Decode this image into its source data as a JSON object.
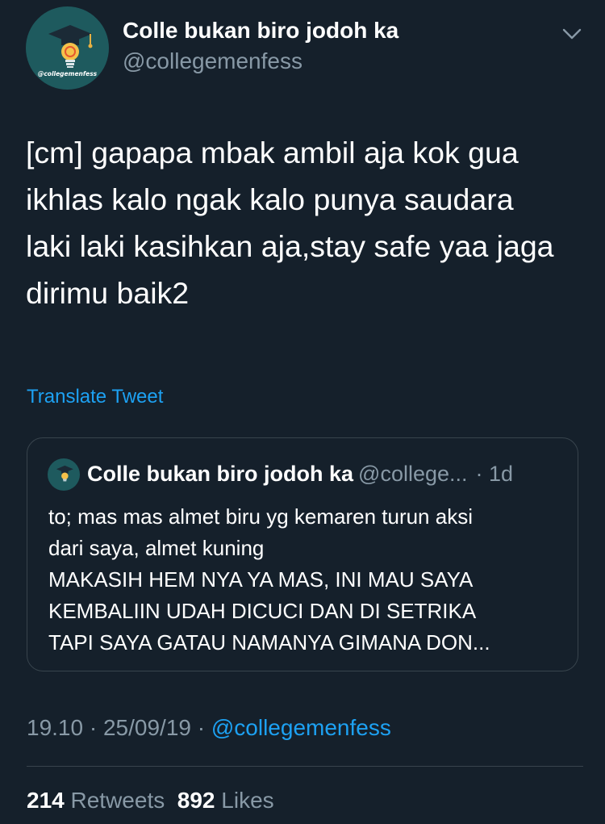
{
  "tweet": {
    "author_name": "Colle bukan biro jodoh ka",
    "author_handle": "@collegemenfess",
    "avatar_label": "@collegemenfess",
    "text": "[cm] gapapa mbak ambil aja kok gua\nikhlas kalo ngak kalo punya saudara\nlaki laki kasihkan aja,stay safe yaa jaga\ndirimu baik2",
    "translate_label": "Translate Tweet",
    "time": "19.10",
    "date": "25/09/19",
    "source": "@collegemenfess",
    "retweets_count": "214",
    "retweets_label": "Retweets",
    "likes_count": "892",
    "likes_label": "Likes"
  },
  "quoted_tweet": {
    "author_name": "Colle bukan biro jodoh ka",
    "author_handle": "@college...",
    "age": "1d",
    "text": "to; mas mas almet biru yg kemaren turun aksi\ndari saya, almet kuning\nMAKASIH HEM NYA YA MAS, INI MAU SAYA\nKEMBALIIN UDAH DICUCI DAN DI SETRIKA\nTAPI SAYA GATAU NAMANYA GIMANA DON..."
  },
  "icons": {
    "menu": "chevron-down-icon",
    "avatar": "graduation-lightbulb-logo"
  },
  "colors": {
    "background": "#15202b",
    "text": "#ffffff",
    "muted": "#8899a6",
    "link": "#1da1f2",
    "border": "#38444d",
    "avatar_bg": "#1e5a5e"
  }
}
